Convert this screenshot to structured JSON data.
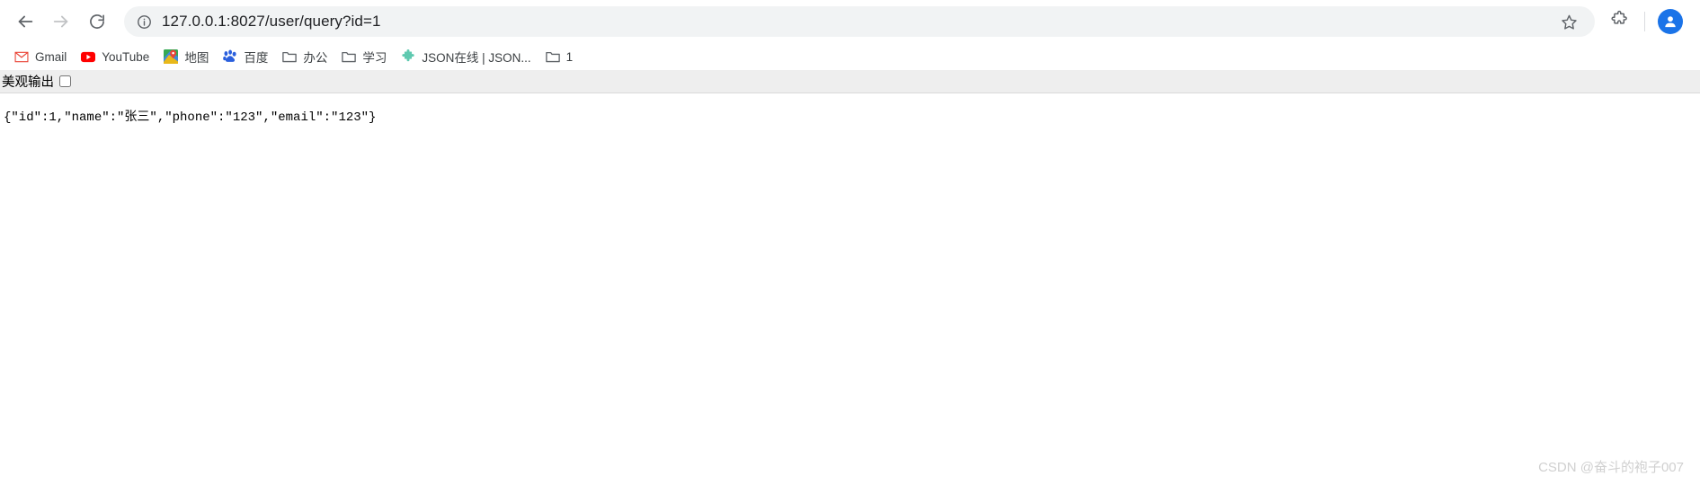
{
  "toolbar": {
    "back_label": "Back",
    "forward_label": "Forward",
    "reload_label": "Reload",
    "site_info_label": "View site information",
    "url": "127.0.0.1:8027/user/query?id=1",
    "bookmark_star_label": "Bookmark this tab",
    "extensions_label": "Extensions",
    "profile_label": "Profile",
    "icons": {
      "back": "back-arrow-icon",
      "forward": "forward-arrow-icon",
      "reload": "reload-icon",
      "site_info": "info-circle-icon",
      "star": "star-icon",
      "extensions": "puzzle-piece-icon",
      "profile": "avatar-icon"
    }
  },
  "bookmarks": {
    "items": [
      {
        "label": "Gmail",
        "icon": "gmail-icon"
      },
      {
        "label": "YouTube",
        "icon": "youtube-icon"
      },
      {
        "label": "地图",
        "icon": "google-maps-icon"
      },
      {
        "label": "百度",
        "icon": "baidu-icon"
      },
      {
        "label": "办公",
        "icon": "folder-icon"
      },
      {
        "label": "学习",
        "icon": "folder-icon"
      },
      {
        "label": "JSON在线 | JSON...",
        "icon": "json-viewer-icon"
      },
      {
        "label": "1",
        "icon": "folder-icon"
      }
    ]
  },
  "page": {
    "pretty_print_label": "美观输出",
    "pretty_print_checked": false,
    "json_output": "{\"id\":1,\"name\":\"张三\",\"phone\":\"123\",\"email\":\"123\"}"
  },
  "watermark": {
    "text": "CSDN @奋斗的袍子007"
  },
  "colors": {
    "accent": "#1a73e8",
    "omnibox_bg": "#f1f3f4",
    "pretty_bar_bg": "#eeeeee",
    "text": "#202124",
    "watermark": "#d0d0d0"
  }
}
